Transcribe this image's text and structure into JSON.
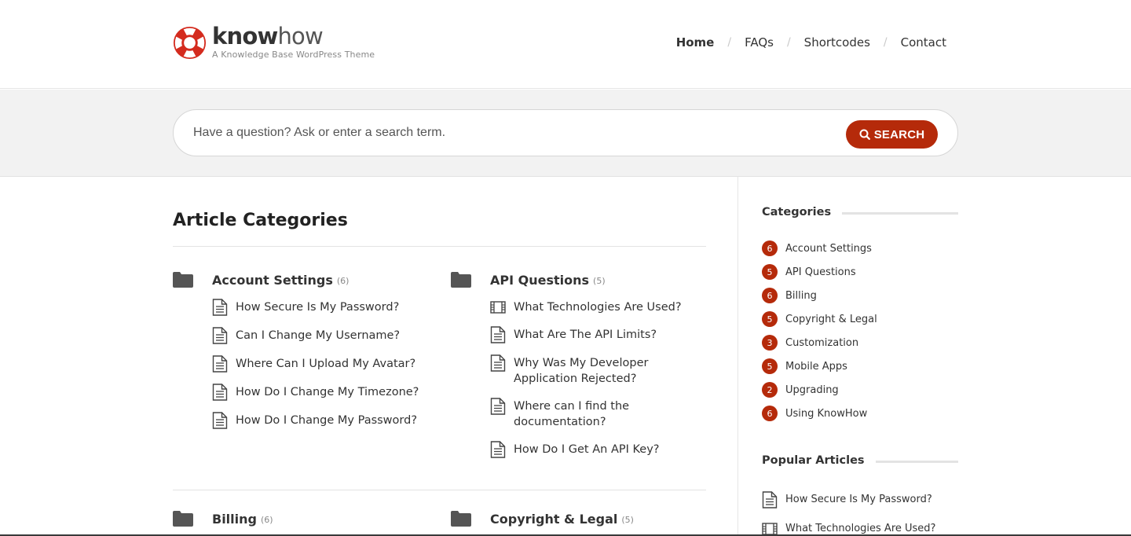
{
  "brand": {
    "name_bold": "know",
    "name_light": "how",
    "tagline": "A Knowledge Base WordPress Theme",
    "accent_color": "#b52a0a"
  },
  "nav": {
    "items": [
      {
        "label": "Home",
        "active": true
      },
      {
        "label": "FAQs"
      },
      {
        "label": "Shortcodes"
      },
      {
        "label": "Contact"
      }
    ],
    "separator": "/"
  },
  "search": {
    "placeholder": "Have a question? Ask or enter a search term.",
    "button_label": "SEARCH"
  },
  "main": {
    "title": "Article Categories",
    "categories": [
      {
        "title": "Account Settings",
        "count": "(6)",
        "articles": [
          {
            "title": "How Secure Is My Password?",
            "icon": "document-icon"
          },
          {
            "title": "Can I Change My Username?",
            "icon": "document-icon"
          },
          {
            "title": "Where Can I Upload My Avatar?",
            "icon": "document-icon"
          },
          {
            "title": "How Do I Change My Timezone?",
            "icon": "document-icon"
          },
          {
            "title": "How Do I Change My Password?",
            "icon": "document-icon"
          }
        ]
      },
      {
        "title": "API Questions",
        "count": "(5)",
        "articles": [
          {
            "title": "What Technologies Are Used?",
            "icon": "film-icon"
          },
          {
            "title": "What Are The API Limits?",
            "icon": "document-icon"
          },
          {
            "title": "Why Was My Developer Application Rejected?",
            "icon": "document-icon"
          },
          {
            "title": "Where can I find the documentation?",
            "icon": "document-icon"
          },
          {
            "title": "How Do I Get An API Key?",
            "icon": "document-icon"
          }
        ]
      },
      {
        "title": "Billing",
        "count": "(6)",
        "articles": []
      },
      {
        "title": "Copyright & Legal",
        "count": "(5)",
        "articles": []
      }
    ]
  },
  "sidebar": {
    "categories_title": "Categories",
    "categories": [
      {
        "count": "6",
        "label": "Account Settings"
      },
      {
        "count": "5",
        "label": "API Questions"
      },
      {
        "count": "6",
        "label": "Billing"
      },
      {
        "count": "5",
        "label": "Copyright & Legal"
      },
      {
        "count": "3",
        "label": "Customization"
      },
      {
        "count": "5",
        "label": "Mobile Apps"
      },
      {
        "count": "2",
        "label": "Upgrading"
      },
      {
        "count": "6",
        "label": "Using KnowHow"
      }
    ],
    "popular_title": "Popular Articles",
    "popular": [
      {
        "label": "How Secure Is My Password?",
        "icon": "document-icon"
      },
      {
        "label": "What Technologies Are Used?",
        "icon": "film-icon"
      }
    ]
  }
}
